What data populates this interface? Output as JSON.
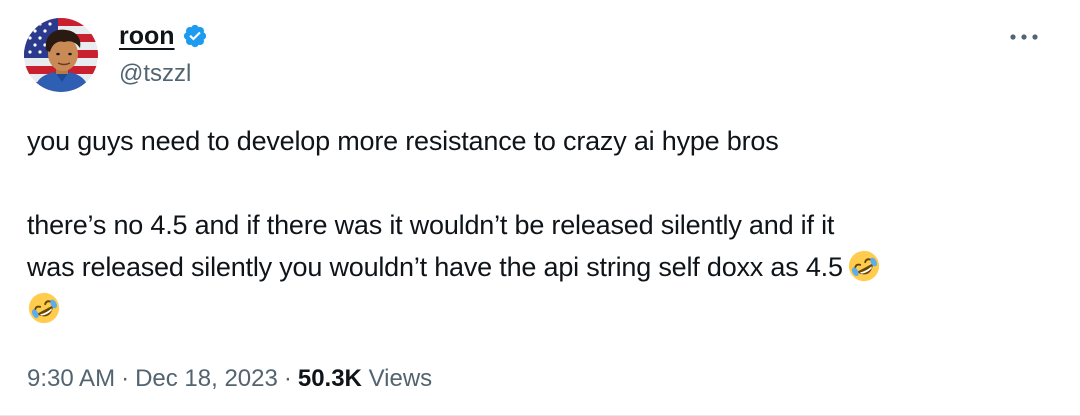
{
  "author": {
    "display_name": "roon",
    "handle": "@tszzl",
    "verified": true,
    "verified_color": "#1d9bf0"
  },
  "icons": {
    "avatar": "avatar-image",
    "verified": "verified-badge-icon",
    "more": "more-options-icon",
    "emoji": "rolling-on-floor-laughing-emoji"
  },
  "tweet": {
    "line1": "you guys need to develop more resistance to crazy ai hype bros",
    "line2": "there’s no 4.5 and if there was it wouldn’t be released silently and if it",
    "line3": "was released silently you wouldn’t have the api string self doxx as 4.5"
  },
  "meta": {
    "time": "9:30 AM",
    "separator": "·",
    "date": "Dec 18, 2023",
    "views_count": "50.3K",
    "views_label": "Views"
  }
}
